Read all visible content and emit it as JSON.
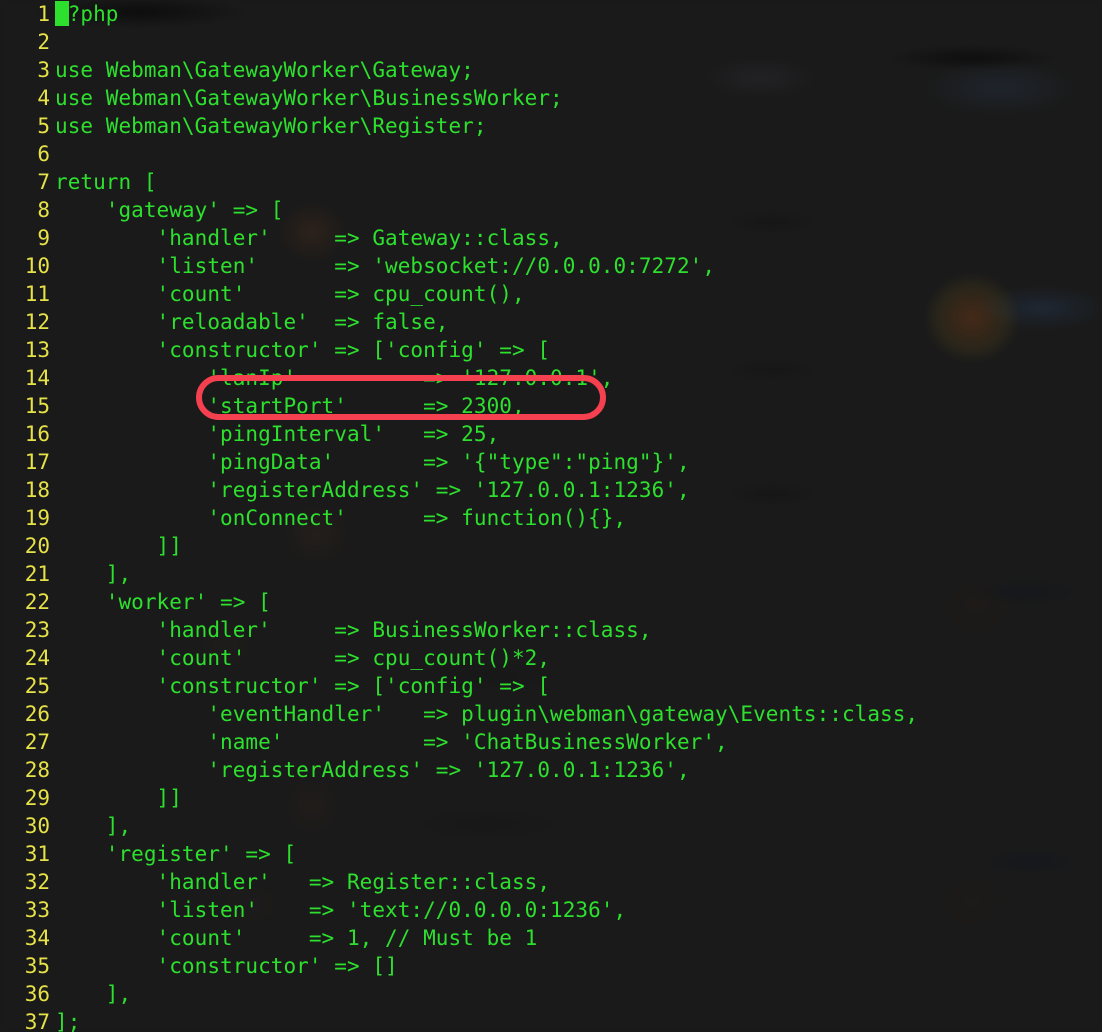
{
  "editor": {
    "language": "php",
    "background_color": "#1a1a1a",
    "code_color": "#2ee02e",
    "line_number_color": "#e6e247",
    "cursor": {
      "line": 1,
      "column": 1,
      "shape": "block",
      "color": "#2ee02e"
    }
  },
  "annotation": {
    "shape": "rounded-rectangle",
    "color": "#f5404f",
    "target_line": 15,
    "target_text": "'startPort'          => 2300,"
  },
  "lines": [
    {
      "number": "1",
      "text": "<?php"
    },
    {
      "number": "2",
      "text": ""
    },
    {
      "number": "3",
      "text": "use Webman\\GatewayWorker\\Gateway;"
    },
    {
      "number": "4",
      "text": "use Webman\\GatewayWorker\\BusinessWorker;"
    },
    {
      "number": "5",
      "text": "use Webman\\GatewayWorker\\Register;"
    },
    {
      "number": "6",
      "text": ""
    },
    {
      "number": "7",
      "text": "return ["
    },
    {
      "number": "8",
      "text": "    'gateway' => ["
    },
    {
      "number": "9",
      "text": "        'handler'     => Gateway::class,"
    },
    {
      "number": "10",
      "text": "        'listen'      => 'websocket://0.0.0.0:7272',"
    },
    {
      "number": "11",
      "text": "        'count'       => cpu_count(),"
    },
    {
      "number": "12",
      "text": "        'reloadable'  => false,"
    },
    {
      "number": "13",
      "text": "        'constructor' => ['config' => ["
    },
    {
      "number": "14",
      "text": "            'lanIp'          => '127.0.0.1',"
    },
    {
      "number": "15",
      "text": "            'startPort'      => 2300,"
    },
    {
      "number": "16",
      "text": "            'pingInterval'   => 25,"
    },
    {
      "number": "17",
      "text": "            'pingData'       => '{\"type\":\"ping\"}',"
    },
    {
      "number": "18",
      "text": "            'registerAddress' => '127.0.0.1:1236',"
    },
    {
      "number": "19",
      "text": "            'onConnect'      => function(){},"
    },
    {
      "number": "20",
      "text": "        ]]"
    },
    {
      "number": "21",
      "text": "    ],"
    },
    {
      "number": "22",
      "text": "    'worker' => ["
    },
    {
      "number": "23",
      "text": "        'handler'     => BusinessWorker::class,"
    },
    {
      "number": "24",
      "text": "        'count'       => cpu_count()*2,"
    },
    {
      "number": "25",
      "text": "        'constructor' => ['config' => ["
    },
    {
      "number": "26",
      "text": "            'eventHandler'   => plugin\\webman\\gateway\\Events::class,"
    },
    {
      "number": "27",
      "text": "            'name'           => 'ChatBusinessWorker',"
    },
    {
      "number": "28",
      "text": "            'registerAddress' => '127.0.0.1:1236',"
    },
    {
      "number": "29",
      "text": "        ]]"
    },
    {
      "number": "30",
      "text": "    ],"
    },
    {
      "number": "31",
      "text": "    'register' => ["
    },
    {
      "number": "32",
      "text": "        'handler'   => Register::class,"
    },
    {
      "number": "33",
      "text": "        'listen'    => 'text://0.0.0.0:1236',"
    },
    {
      "number": "34",
      "text": "        'count'     => 1, // Must be 1"
    },
    {
      "number": "35",
      "text": "        'constructor' => []"
    },
    {
      "number": "36",
      "text": "    ],"
    },
    {
      "number": "37",
      "text": "];"
    }
  ]
}
